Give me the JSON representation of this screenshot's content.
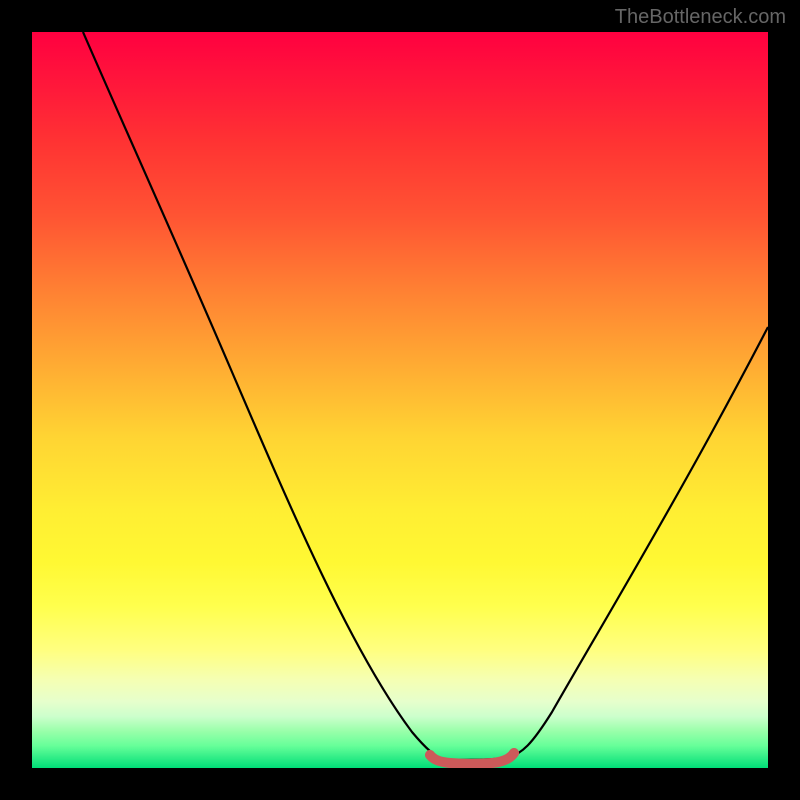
{
  "watermark": "TheBottleneck.com",
  "chart_data": {
    "type": "line",
    "title": "",
    "xlabel": "",
    "ylabel": "",
    "xlim": [
      0,
      100
    ],
    "ylim": [
      0,
      100
    ],
    "grid": false,
    "legend": false,
    "background_gradient": {
      "top": "#ff0040",
      "upper_mid": "#ff8033",
      "mid": "#ffee33",
      "lower": "#ffff80",
      "bottom": "#00dd77"
    },
    "description": "V-shaped bottleneck curve with flat trough on gradient background",
    "series": [
      {
        "name": "bottleneck-curve",
        "color": "#000000",
        "x": [
          7,
          12,
          18,
          24,
          30,
          36,
          42,
          48,
          52,
          55,
          58,
          62,
          65,
          70,
          76,
          82,
          88,
          94,
          100
        ],
        "y": [
          100,
          90,
          80,
          70,
          60,
          48,
          36,
          22,
          10,
          3,
          0,
          0,
          3,
          12,
          25,
          38,
          50,
          60,
          70
        ]
      },
      {
        "name": "trough-marker",
        "color": "#cc5a5a",
        "x": [
          54,
          56,
          58,
          60,
          62,
          64
        ],
        "y": [
          1.2,
          0.8,
          0.6,
          0.6,
          0.8,
          1.5
        ]
      }
    ]
  }
}
